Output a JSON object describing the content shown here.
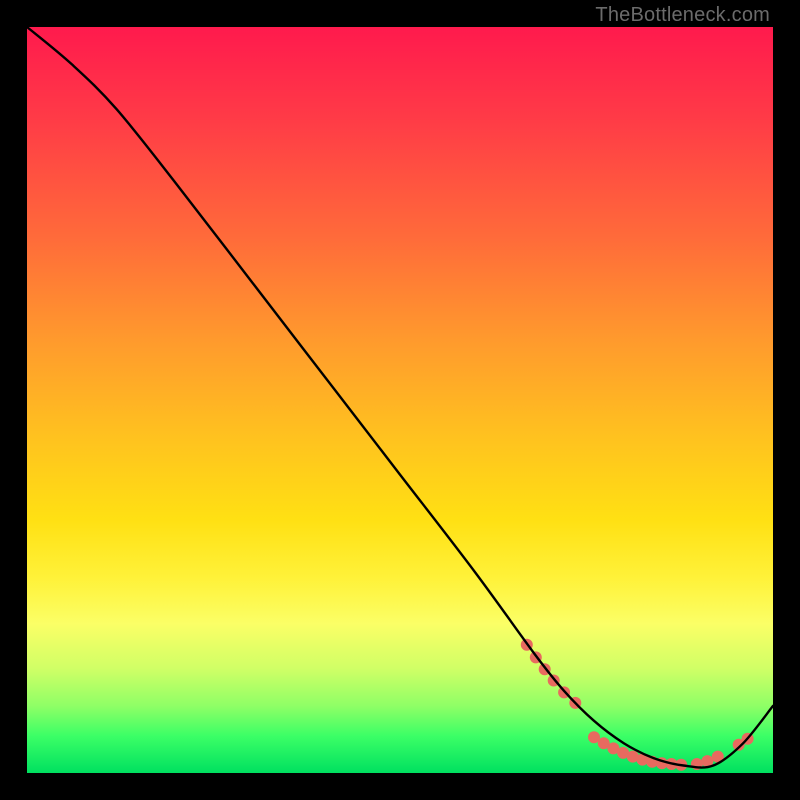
{
  "watermark": "TheBottleneck.com",
  "chart_data": {
    "type": "line",
    "title": "",
    "xlabel": "",
    "ylabel": "",
    "xlim": [
      0,
      100
    ],
    "ylim": [
      0,
      100
    ],
    "grid": false,
    "legend": false,
    "series": [
      {
        "name": "curve",
        "color": "#000000",
        "x": [
          0,
          6,
          12,
          20,
          30,
          40,
          50,
          60,
          68,
          72,
          76,
          80,
          84,
          88,
          92,
          96,
          100
        ],
        "y": [
          100,
          95,
          89,
          79,
          66,
          53,
          40,
          27,
          16,
          11,
          7,
          4,
          2,
          1,
          1,
          4,
          9
        ]
      }
    ],
    "markers": [
      {
        "name": "segment-dots",
        "color": "#e86a5f",
        "radius": 6,
        "x": [
          67.0,
          68.2,
          69.4,
          70.6,
          72.0,
          73.5,
          76.0,
          77.3,
          78.6,
          79.9,
          81.2,
          82.5,
          83.8,
          85.1,
          86.4,
          87.7,
          89.8,
          91.2,
          92.6,
          95.4,
          96.6
        ],
        "y": [
          17.2,
          15.5,
          13.9,
          12.4,
          10.8,
          9.4,
          4.8,
          4.0,
          3.3,
          2.7,
          2.2,
          1.8,
          1.5,
          1.3,
          1.2,
          1.1,
          1.2,
          1.6,
          2.2,
          3.8,
          4.6
        ]
      }
    ]
  }
}
